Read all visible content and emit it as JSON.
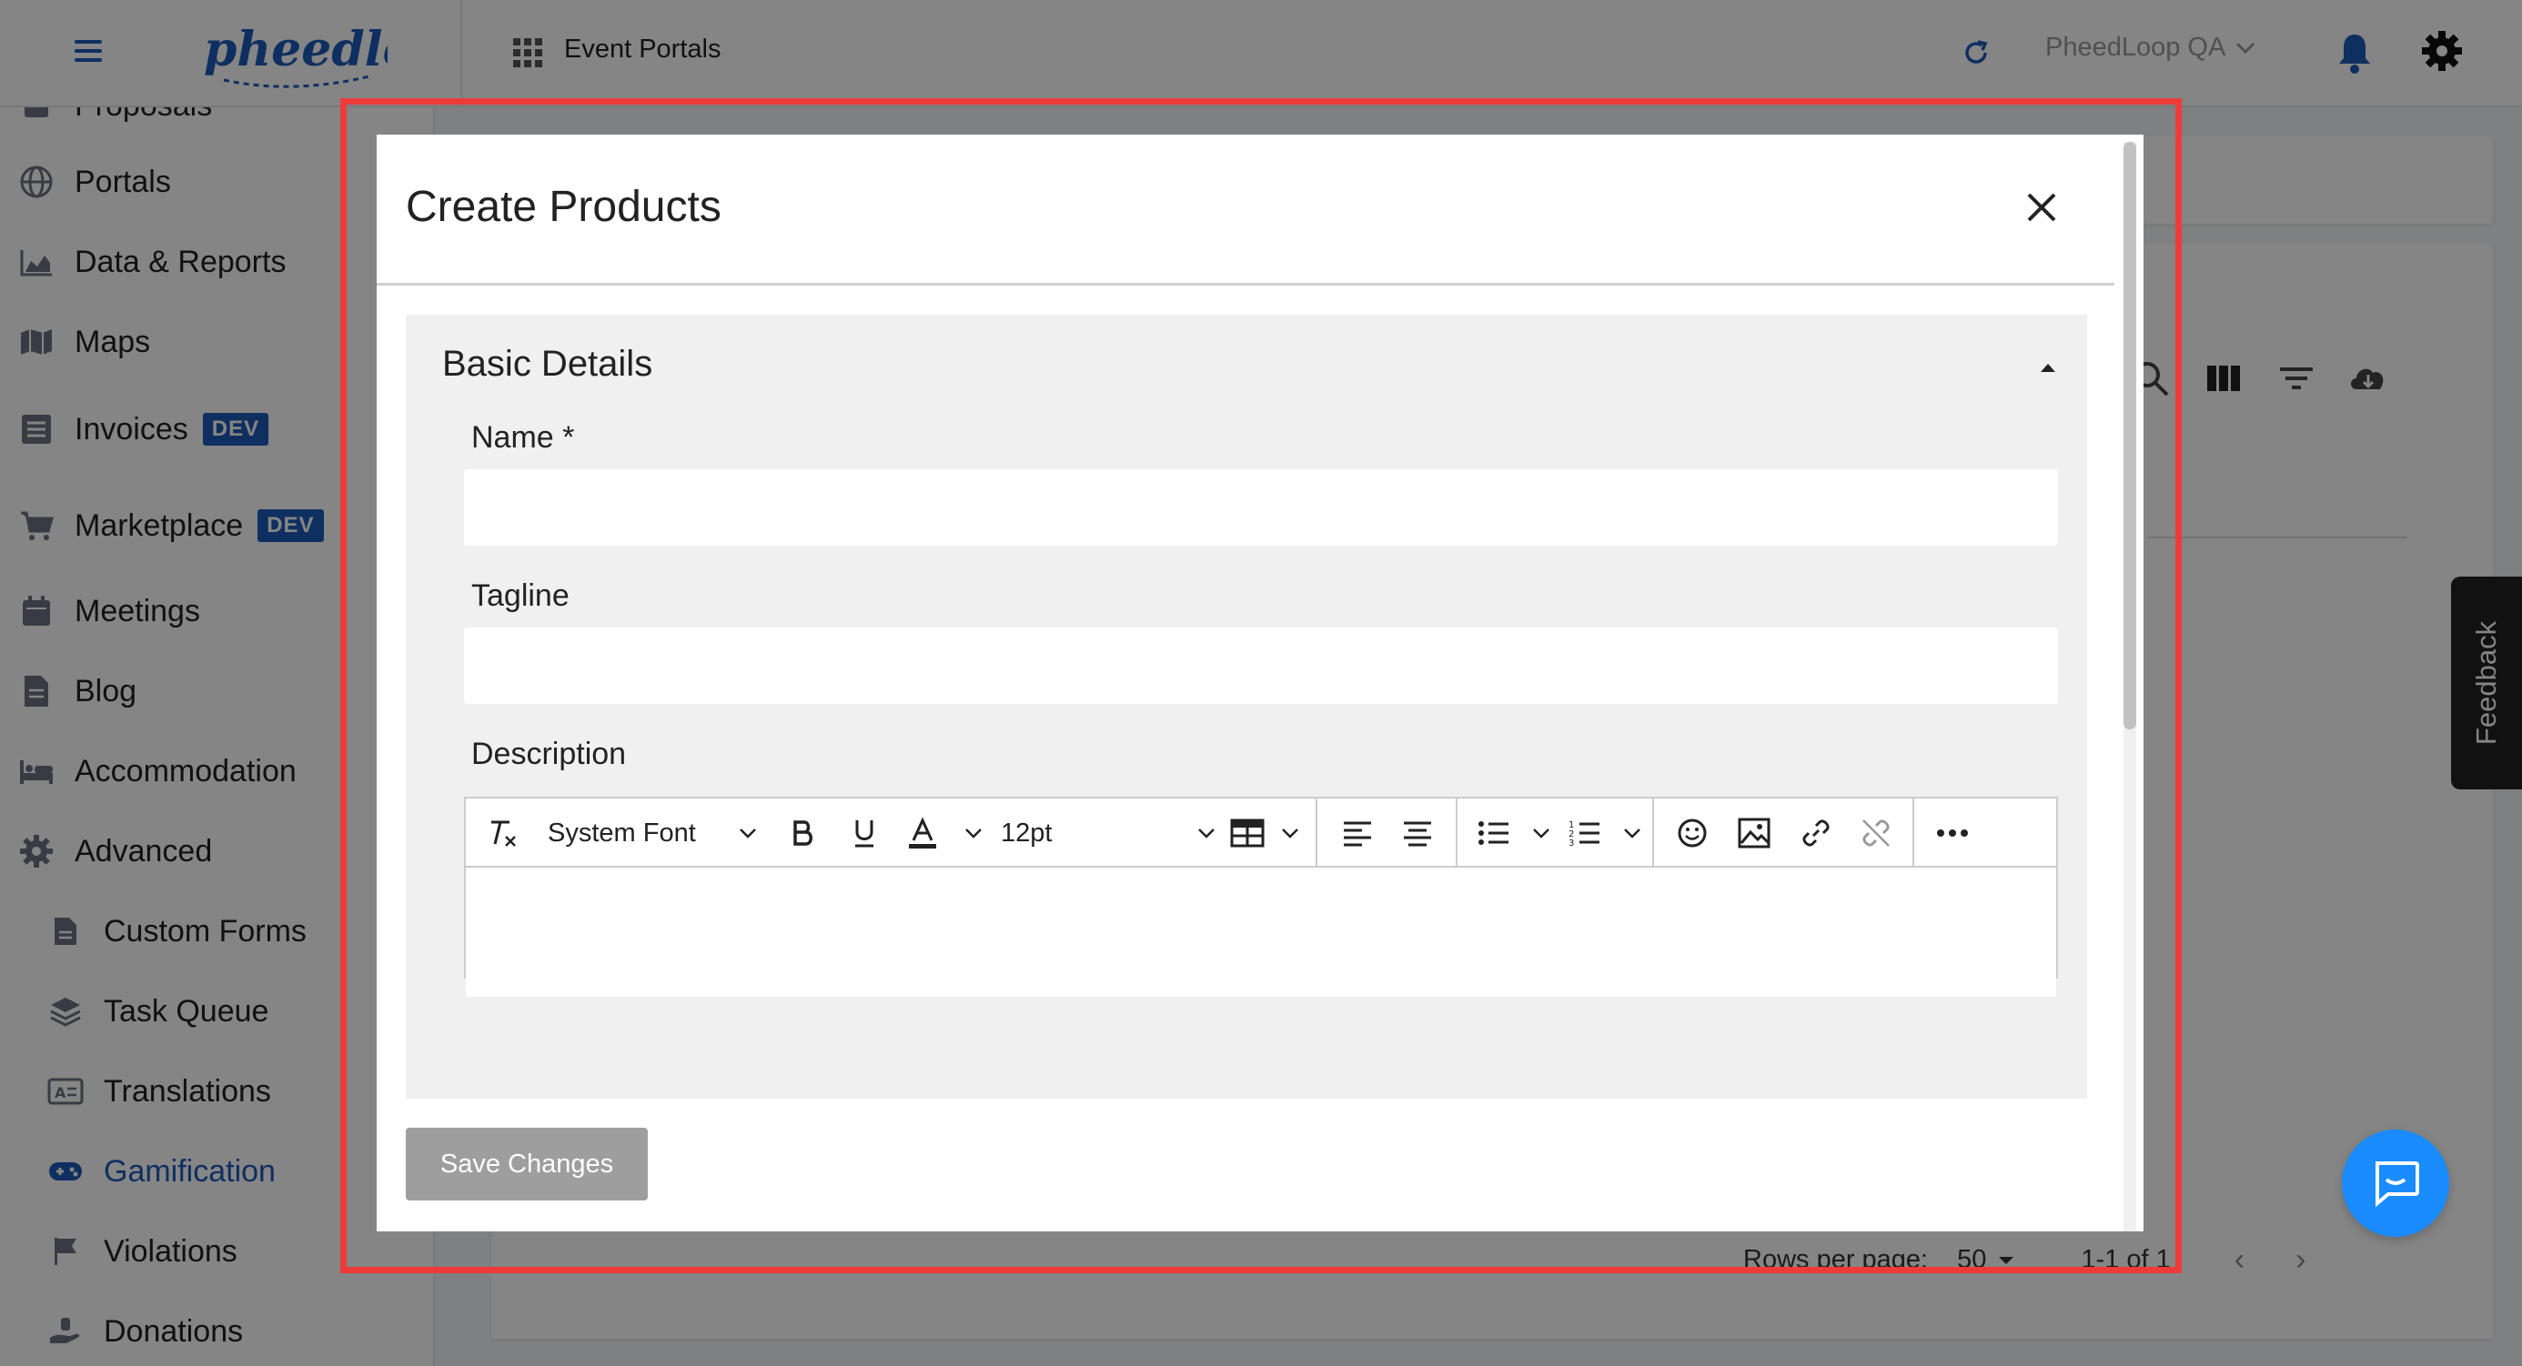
{
  "header": {
    "app_section": "Event Portals",
    "org_name": "PheedLoop QA"
  },
  "sidebar": {
    "items": [
      {
        "label": "Proposals"
      },
      {
        "label": "Portals"
      },
      {
        "label": "Data & Reports"
      },
      {
        "label": "Maps"
      },
      {
        "label": "Invoices",
        "badge": "DEV"
      },
      {
        "label": "Marketplace",
        "badge": "DEV"
      },
      {
        "label": "Meetings"
      },
      {
        "label": "Blog"
      },
      {
        "label": "Accommodation"
      },
      {
        "label": "Advanced"
      },
      {
        "label": "Custom Forms"
      },
      {
        "label": "Task Queue"
      },
      {
        "label": "Translations"
      },
      {
        "label": "Gamification",
        "active": true
      },
      {
        "label": "Violations"
      },
      {
        "label": "Donations"
      }
    ]
  },
  "table_footer": {
    "rows_per_page_label": "Rows per page:",
    "rows_per_page_value": "50",
    "range": "1-1 of 1"
  },
  "feedback": {
    "label": "Feedback"
  },
  "modal": {
    "title": "Create Products",
    "section": {
      "title": "Basic Details",
      "fields": {
        "name": {
          "label": "Name *",
          "value": "",
          "placeholder": ""
        },
        "tagline": {
          "label": "Tagline",
          "value": "",
          "placeholder": ""
        },
        "description": {
          "label": "Description"
        }
      },
      "editor_toolbar": {
        "font_family": "System Font",
        "font_size": "12pt"
      }
    },
    "save_label": "Save Changes"
  },
  "colors": {
    "brand": "#1e5bb8",
    "highlight": "#ef3a3a",
    "chat": "#1a8cff",
    "save_disabled": "#9e9e9e"
  }
}
